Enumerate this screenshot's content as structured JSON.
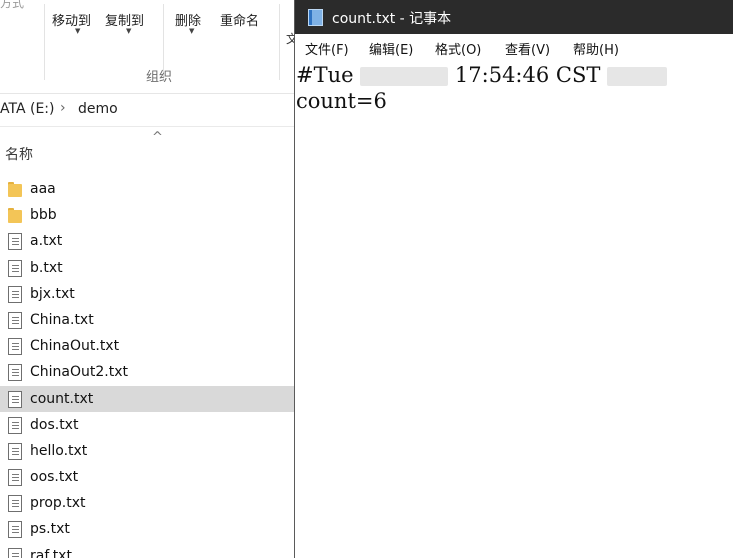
{
  "explorer": {
    "ribbon": {
      "cut_label": "方式",
      "buttons": [
        {
          "label": "移动到"
        },
        {
          "label": "复制到"
        },
        {
          "label": "删除"
        },
        {
          "label": "重命名"
        }
      ],
      "group_label": "组织"
    },
    "address": {
      "segments": [
        "ATA (E:)",
        "demo"
      ]
    },
    "columns": {
      "name_header": "名称"
    },
    "files": [
      {
        "name": "aaa",
        "type": "folder",
        "selected": false
      },
      {
        "name": "bbb",
        "type": "folder",
        "selected": false
      },
      {
        "name": "a.txt",
        "type": "file",
        "selected": false
      },
      {
        "name": "b.txt",
        "type": "file",
        "selected": false
      },
      {
        "name": "bjx.txt",
        "type": "file",
        "selected": false
      },
      {
        "name": "China.txt",
        "type": "file",
        "selected": false
      },
      {
        "name": "ChinaOut.txt",
        "type": "file",
        "selected": false
      },
      {
        "name": "ChinaOut2.txt",
        "type": "file",
        "selected": false
      },
      {
        "name": "count.txt",
        "type": "file",
        "selected": true
      },
      {
        "name": "dos.txt",
        "type": "file",
        "selected": false
      },
      {
        "name": "hello.txt",
        "type": "file",
        "selected": false
      },
      {
        "name": "oos.txt",
        "type": "file",
        "selected": false
      },
      {
        "name": "prop.txt",
        "type": "file",
        "selected": false
      },
      {
        "name": "ps.txt",
        "type": "file",
        "selected": false
      },
      {
        "name": "raf.txt",
        "type": "file",
        "selected": false
      }
    ]
  },
  "notepad": {
    "title": "count.txt - 记事本",
    "menu": [
      {
        "label": "文件(F)"
      },
      {
        "label": "编辑(E)"
      },
      {
        "label": "格式(O)"
      },
      {
        "label": "查看(V)"
      },
      {
        "label": "帮助(H)"
      }
    ],
    "content": {
      "line1_prefix": "#Tue ",
      "line1_time": " 17:54:46 CST ",
      "line2": "count=6"
    }
  },
  "colors": {
    "titlebar": "#2b2b2b",
    "selection": "#d9d9d9",
    "folder": "#f3c557"
  }
}
